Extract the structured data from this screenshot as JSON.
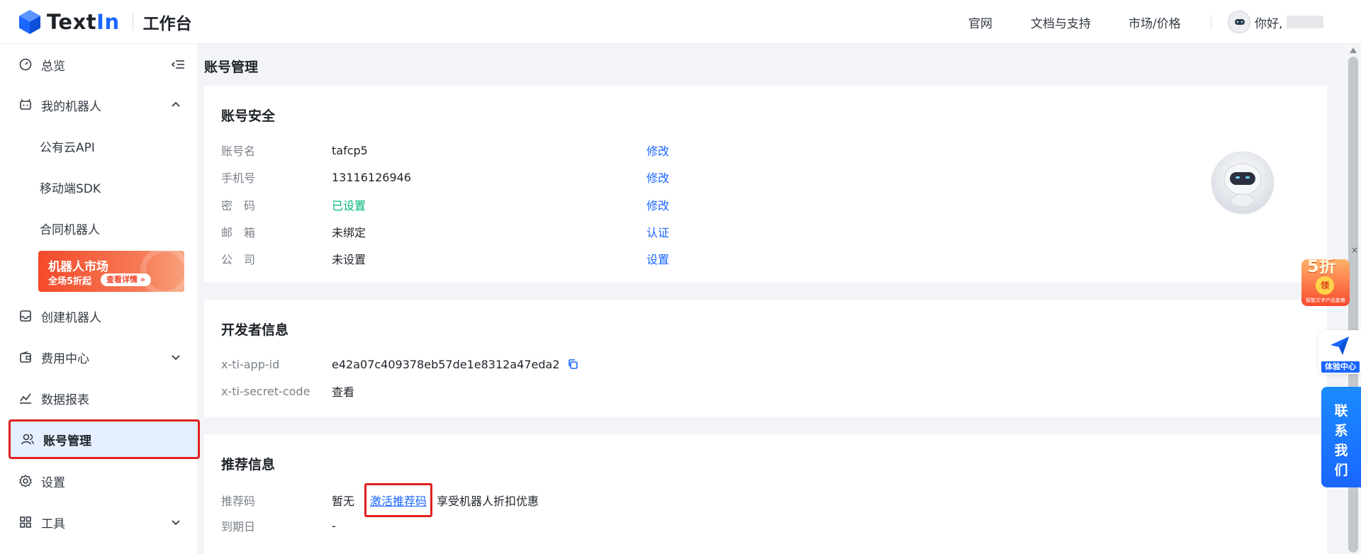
{
  "header": {
    "brand_prefix": "Text",
    "brand_suffix": "In",
    "product": "工作台",
    "nav": [
      "官网",
      "文档与支持",
      "市场/价格"
    ],
    "greeting": "你好,"
  },
  "sidebar": {
    "items": [
      {
        "label": "总览",
        "icon": "dashboard-icon"
      },
      {
        "label": "我的机器人",
        "icon": "robot-icon"
      },
      {
        "label": "公有云API"
      },
      {
        "label": "移动端SDK"
      },
      {
        "label": "合同机器人"
      },
      {
        "label": "创建机器人",
        "icon": "inbox-icon"
      },
      {
        "label": "费用中心",
        "icon": "wallet-icon"
      },
      {
        "label": "数据报表",
        "icon": "chart-icon"
      },
      {
        "label": "账号管理",
        "icon": "users-icon"
      },
      {
        "label": "设置",
        "icon": "gear-icon"
      },
      {
        "label": "工具",
        "icon": "grid-icon"
      }
    ],
    "promo": {
      "title": "机器人市场",
      "subtitle": "全场5折起",
      "button": "查看详情 »"
    }
  },
  "main": {
    "page_title": "账号管理",
    "account_security": {
      "title": "账号安全",
      "rows": [
        {
          "label": "账号名",
          "value": "tafcp5",
          "action": "修改"
        },
        {
          "label": "手机号",
          "value": "13116126946",
          "action": "修改"
        },
        {
          "label": "密　码",
          "value": "已设置",
          "action": "修改"
        },
        {
          "label": "邮　箱",
          "value": "未绑定",
          "action": "认证"
        },
        {
          "label": "公　司",
          "value": "未设置",
          "action": "设置"
        }
      ]
    },
    "developer": {
      "title": "开发者信息",
      "app_id_label": "x-ti-app-id",
      "app_id_value": "e42a07c409378eb57de1e8312a47eda2",
      "secret_label": "x-ti-secret-code",
      "secret_action": "查看"
    },
    "referral": {
      "title": "推荐信息",
      "code_label": "推荐码",
      "code_value": "暂无",
      "activate_link": "激活推荐码",
      "benefit_text": "享受机器人折扣优惠",
      "expire_label": "到期日",
      "expire_value": "-"
    }
  },
  "floating": {
    "discount_big": "5折",
    "discount_coin": "领",
    "discount_tiny": "智能文字产品套餐",
    "close": "×",
    "experience": "体验中心",
    "contact": "联系我们"
  },
  "colors": {
    "accent": "#1a66ff",
    "success": "#00b578",
    "highlight": "#e02020",
    "active_bg": "#e5efff"
  }
}
